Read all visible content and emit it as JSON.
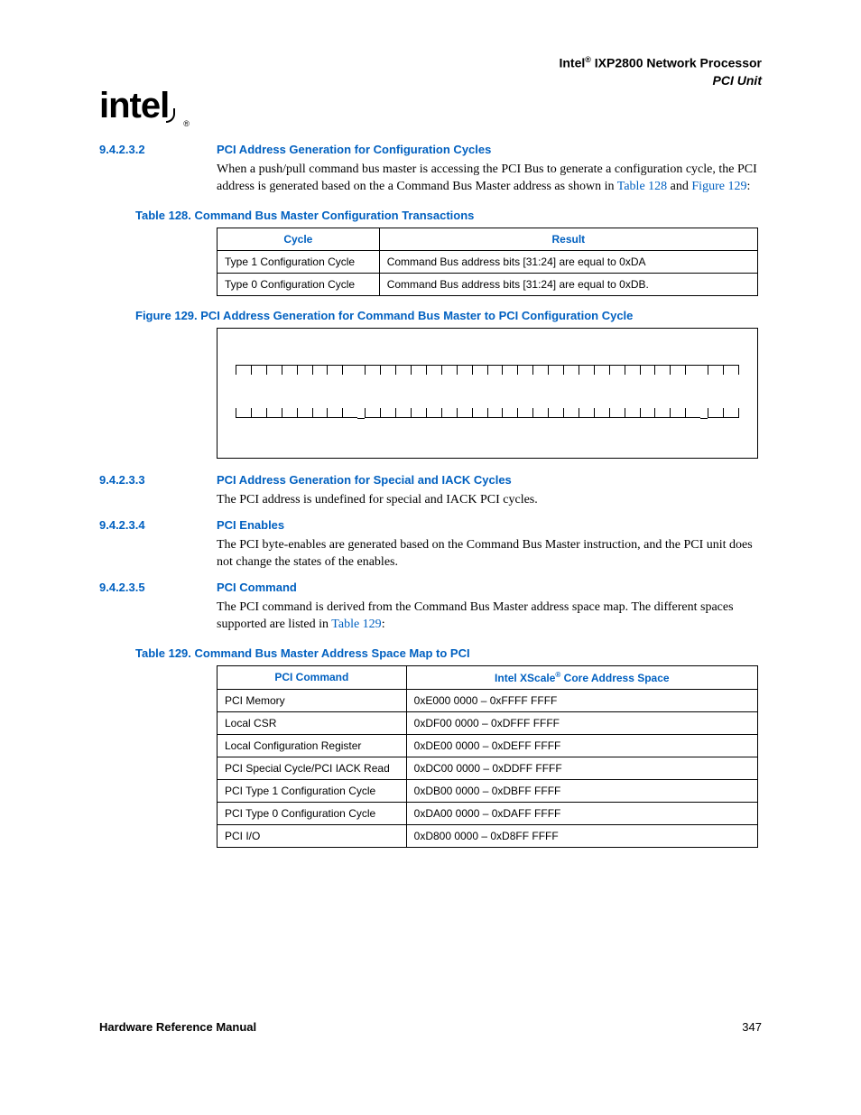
{
  "header": {
    "brand": "Intel",
    "product": " IXP2800 Network Processor",
    "subtitle": "PCI Unit"
  },
  "logo": {
    "text": "intel",
    "reg": "®"
  },
  "sections": [
    {
      "num": "9.4.2.3.2",
      "title": "PCI Address Generation for Configuration Cycles",
      "para": "When a push/pull command bus master is accessing the PCI Bus to generate a configuration cycle, the PCI address is generated based on the a Command Bus Master address as shown in ",
      "xref1": "Table 128",
      "mid": " and ",
      "xref2": "Figure 129",
      "tail": ":"
    },
    {
      "num": "9.4.2.3.3",
      "title": "PCI Address Generation for Special and IACK Cycles",
      "para": "The PCI address is undefined for special and IACK PCI cycles."
    },
    {
      "num": "9.4.2.3.4",
      "title": "PCI Enables",
      "para": "The PCI byte-enables are generated based on the Command Bus Master instruction, and the PCI unit does not change the states of the enables."
    },
    {
      "num": "9.4.2.3.5",
      "title": "PCI Command",
      "para": "The PCI command is derived from the Command Bus Master address space map. The different spaces supported are listed in ",
      "xref1": "Table 129",
      "tail": ":"
    }
  ],
  "table128": {
    "caption": "Table 128. Command Bus Master Configuration Transactions",
    "headers": [
      "Cycle",
      "Result"
    ],
    "rows": [
      [
        "Type 1 Configuration Cycle",
        "Command Bus address bits [31:24] are equal to 0xDA"
      ],
      [
        "Type 0 Configuration Cycle",
        "Command Bus address bits [31:24] are equal to 0xDB."
      ]
    ]
  },
  "figure129": {
    "caption": "Figure 129. PCI Address Generation for Command Bus Master to PCI Configuration Cycle"
  },
  "table129": {
    "caption": "Table 129. Command Bus Master Address Space Map to PCI",
    "headers": [
      "PCI Command",
      "Intel XScale",
      " Core Address Space"
    ],
    "reg": "®",
    "rows": [
      [
        "PCI Memory",
        "0xE000 0000 – 0xFFFF FFFF"
      ],
      [
        "Local CSR",
        "0xDF00 0000 – 0xDFFF FFFF"
      ],
      [
        "Local Configuration Register",
        "0xDE00 0000 – 0xDEFF FFFF"
      ],
      [
        "PCI Special Cycle/PCI IACK Read",
        "0xDC00 0000 – 0xDDFF FFFF"
      ],
      [
        "PCI Type 1 Configuration Cycle",
        "0xDB00 0000 – 0xDBFF FFFF"
      ],
      [
        "PCI Type 0 Configuration Cycle",
        "0xDA00 0000 – 0xDAFF FFFF"
      ],
      [
        "PCI I/O",
        "0xD800 0000 – 0xD8FF FFFF"
      ]
    ]
  },
  "footer": {
    "left": "Hardware Reference Manual",
    "right": "347"
  }
}
